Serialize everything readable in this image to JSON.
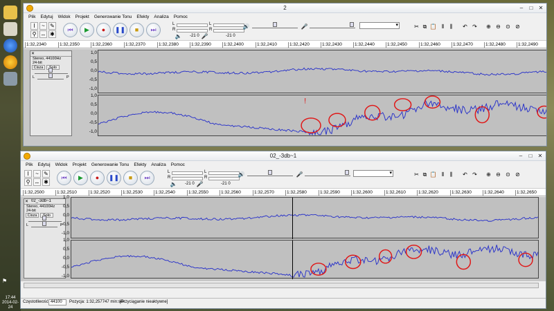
{
  "desktop": {
    "clock_time": "17:44",
    "clock_date": "2014-02-24",
    "tray_flag": "⚑"
  },
  "colors": {
    "waveform": "#2c35c9",
    "annotation": "#e01818",
    "ruler_bg": "#ffffff",
    "track_bg": "#c0c0c0"
  },
  "icons": [
    "folder-icon",
    "ie-icon",
    "audacity-icon",
    "settings-icon"
  ],
  "windows": [
    {
      "title": "2",
      "menu": [
        "Plik",
        "Edytuj",
        "Widok",
        "Projekt",
        "Generowanie Tonu",
        "Efekty",
        "Analiza",
        "Pomoc"
      ],
      "meter_left": "-21 0",
      "meter_right": "-21 0",
      "lr_l": "L",
      "lr_r": "R",
      "ruler": [
        "1:32,2340",
        "1:32,2350",
        "1:32,2360",
        "1:32,2370",
        "1:32,2380",
        "1:32,2390",
        "1:32,2400",
        "1:32,2410",
        "1:32,2420",
        "1:32,2430",
        "1:32,2440",
        "1:32,2450",
        "1:32,2460",
        "1:32,2470",
        "1:32,2480",
        "1:32,2490"
      ],
      "track": {
        "name": "",
        "info": "Stereo, 44100Hz",
        "format": "24-bit",
        "mute": "Cisza",
        "solo": "Solo",
        "l": "L",
        "p": "P"
      },
      "scale": [
        "1,0",
        "0,5",
        "0,0",
        "-0,5",
        "-1,0"
      ],
      "annotation_mark": "!"
    },
    {
      "title": "02_-3db~1",
      "menu": [
        "Plik",
        "Edytuj",
        "Widok",
        "Projekt",
        "Generowanie Tonu",
        "Efekty",
        "Analiza",
        "Pomoc"
      ],
      "meter_left": "-21 0",
      "meter_right": "-21 0",
      "lr_l": "L",
      "lr_r": "R",
      "ruler": [
        "1:32,2500",
        "1:32,2510",
        "1:32,2520",
        "1:32,2530",
        "1:32,2540",
        "1:32,2550",
        "1:32,2560",
        "1:32,2570",
        "1:32,2580",
        "1:32,2590",
        "1:32,2600",
        "1:32,2610",
        "1:32,2620",
        "1:32,2630",
        "1:32,2640",
        "1:32,2650"
      ],
      "track": {
        "name": "02_-3db~1",
        "info": "Stereo, 44100Hz",
        "format": "24-bit",
        "mute": "Cisza",
        "solo": "Solo",
        "l": "L",
        "p": "P"
      },
      "scale": [
        "1,0",
        "0,5",
        "0,0",
        "-0,5",
        "-1,0"
      ],
      "status": {
        "rate_label": "Częstotliwość:",
        "rate_value": "44100",
        "position": "Pozycja: 1:32,257747 min:sek",
        "snap": "[Przyciąganie nieaktywne]"
      }
    }
  ]
}
